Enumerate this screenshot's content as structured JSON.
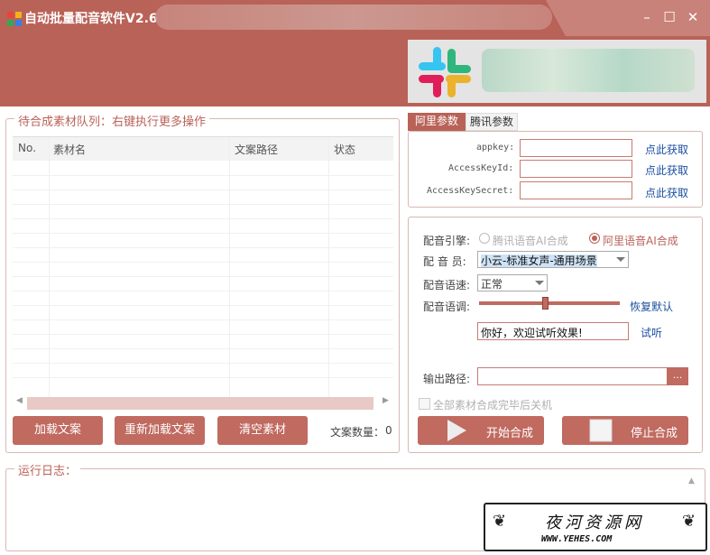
{
  "window": {
    "title": "自动批量配音软件V2.6",
    "controls": {
      "minimize": "–",
      "maximize": "☐",
      "close": "✕"
    }
  },
  "queue": {
    "legend": "待合成素材队列：右键执行更多操作",
    "columns": [
      "No.",
      "素材名",
      "文案路径",
      "状态"
    ],
    "rows": [],
    "buttons": {
      "load": "加载文案",
      "reload": "重新加载文案",
      "clear": "清空素材"
    },
    "count_label": "文案数量：",
    "count_value": "0"
  },
  "params": {
    "tabs": [
      "阿里参数",
      "腾讯参数"
    ],
    "active_tab": "阿里参数",
    "fields": [
      {
        "label": "appkey:",
        "value": "",
        "link": "点此获取"
      },
      {
        "label": "AccessKeyId:",
        "value": "",
        "link": "点此获取"
      },
      {
        "label": "AccessKeySecret:",
        "value": "",
        "link": "点此获取"
      }
    ]
  },
  "synth": {
    "engine_label": "配音引擎:",
    "engine_options": [
      "腾讯语音AI合成",
      "阿里语音AI合成"
    ],
    "engine_selected": "阿里语音AI合成",
    "voice_label": "配 音 员:",
    "voice_value": "小云-标准女声-通用场景",
    "speed_label": "配音语速:",
    "speed_value": "正常",
    "pitch_label": "配音语调:",
    "pitch_level": 0.45,
    "reset_label": "恢复默认",
    "preview_text": "你好，欢迎试听效果!",
    "listen_label": "试听",
    "output_label": "输出路径:",
    "output_value": "",
    "browse_label": "...",
    "shutdown_label": "全部素材合成完毕后关机",
    "start_label": "开始合成",
    "stop_label": "停止合成"
  },
  "log": {
    "legend": "运行日志："
  },
  "watermark": {
    "title": "夜河资源网",
    "url": "WWW.YEHES.COM"
  },
  "colors": {
    "accent": "#b96257",
    "button": "#c06a60",
    "link": "#1a4fa0"
  }
}
